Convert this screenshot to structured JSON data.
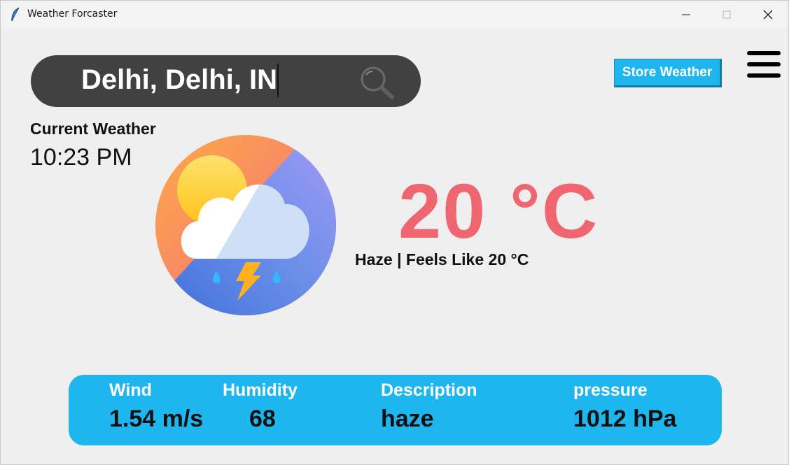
{
  "window": {
    "title": "Weather Forcaster"
  },
  "search": {
    "value": "Delhi, Delhi, IN",
    "icon": "search-icon"
  },
  "toolbar": {
    "store_label": "Store Weather",
    "menu_icon": "hamburger-menu-icon"
  },
  "current": {
    "label": "Current Weather",
    "time": "10:23 PM",
    "temperature": "20 °C",
    "summary": "Haze | Feels Like 20 °C",
    "icon": "cloud-rain-thunder-sun-icon"
  },
  "stats": {
    "wind_label": "Wind",
    "wind_value": "1.54 m/s",
    "humidity_label": "Humidity",
    "humidity_value": "68",
    "description_label": "Description",
    "description_value": "haze",
    "pressure_label": "pressure",
    "pressure_value": "1012 hPa"
  },
  "colors": {
    "accent": "#1db6ee",
    "temperature": "#ef6670",
    "search_bg": "#414141",
    "background": "#f0eff0"
  }
}
